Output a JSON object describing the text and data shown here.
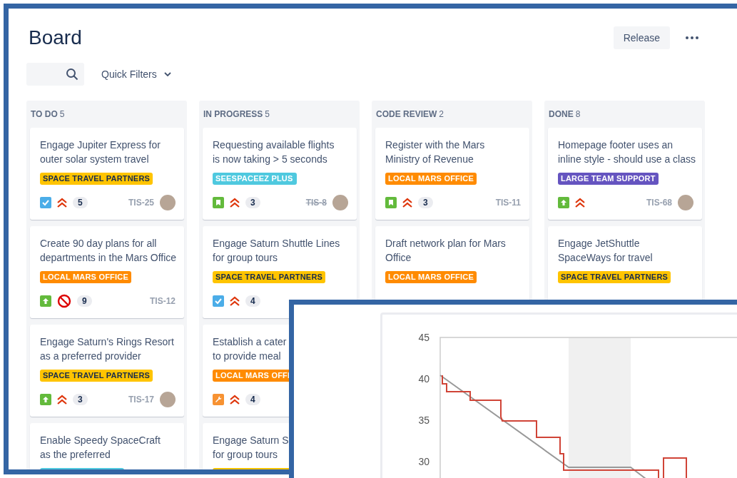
{
  "header": {
    "title": "Board",
    "release": "Release"
  },
  "toolbar": {
    "quick_filters": "Quick Filters"
  },
  "columns": [
    {
      "title": "TO DO",
      "count": "5",
      "cards": [
        {
          "lines": [
            "Engage Jupiter Express for",
            "outer solar system travel"
          ],
          "label": {
            "text": "SPACE TRAVEL PARTNERS",
            "color": "#ffc400"
          },
          "icons": [
            {
              "kind": "task"
            },
            {
              "kind": "highest"
            }
          ],
          "count": "5",
          "key": "TIS-25",
          "resolved": false,
          "assignee": true
        },
        {
          "lines": [
            "Create 90 day plans for all",
            "departments in the Mars Office"
          ],
          "label": {
            "text": "LOCAL MARS OFFICE",
            "color": "#ff8b00"
          },
          "icons": [
            {
              "kind": "improvement"
            },
            {
              "kind": "blocker"
            }
          ],
          "count": "9",
          "key": "TIS-12",
          "resolved": false,
          "assignee": false
        },
        {
          "lines": [
            "Engage Saturn's Rings Resort",
            "as a preferred provider"
          ],
          "label": {
            "text": "SPACE TRAVEL PARTNERS",
            "color": "#ffc400"
          },
          "icons": [
            {
              "kind": "improvement"
            },
            {
              "kind": "highest"
            }
          ],
          "count": "3",
          "key": "TIS-17",
          "resolved": false,
          "assignee": true
        },
        {
          "lines": [
            "Enable Speedy SpaceCraft",
            "as the preferred"
          ],
          "label": {
            "color": "#4fc9df"
          }
        }
      ]
    },
    {
      "title": "IN PROGRESS",
      "count": "5",
      "cards": [
        {
          "lines": [
            "Requesting available flights",
            "is now taking > 5 seconds"
          ],
          "label": {
            "text": "SEESPACEEZ PLUS",
            "color": "#4fc9df"
          },
          "icons": [
            {
              "kind": "story"
            },
            {
              "kind": "highest"
            }
          ],
          "count": "3",
          "key": "TIS-8",
          "resolved": true,
          "assignee": true
        },
        {
          "lines": [
            "Engage Saturn Shuttle Lines",
            "for group tours"
          ],
          "label": {
            "text": "SPACE TRAVEL PARTNERS",
            "color": "#ffc400"
          },
          "icons": [
            {
              "kind": "task"
            },
            {
              "kind": "highest"
            }
          ],
          "count": "4"
        },
        {
          "lines": [
            "Establish a cater",
            "to provide meal"
          ],
          "label": {
            "text": "LOCAL MARS OFFI",
            "color": "#ff8b00"
          },
          "icons": [
            {
              "kind": "wrench"
            },
            {
              "kind": "highest"
            }
          ],
          "count": "4"
        },
        {
          "lines": [
            "Engage Saturn S",
            "for group tours"
          ],
          "label": {
            "color": "#ffc400"
          }
        }
      ]
    },
    {
      "title": "CODE REVIEW",
      "count": "2",
      "cards": [
        {
          "lines": [
            "Register with the Mars",
            "Ministry of Revenue"
          ],
          "label": {
            "text": "LOCAL MARS OFFICE",
            "color": "#ff8b00"
          },
          "icons": [
            {
              "kind": "story"
            },
            {
              "kind": "highest"
            }
          ],
          "count": "3",
          "key": "TIS-11",
          "resolved": false,
          "assignee": false
        },
        {
          "lines": [
            "Draft network plan for Mars",
            "Office"
          ],
          "label": {
            "text": "LOCAL MARS OFFICE",
            "color": "#ff8b00"
          }
        }
      ]
    },
    {
      "title": "DONE",
      "count": "8",
      "cards": [
        {
          "lines": [
            "Homepage footer uses an",
            "inline style - should use a class"
          ],
          "label": {
            "text": "LARGE TEAM SUPPORT",
            "color": "#6554c0"
          },
          "icons": [
            {
              "kind": "improvement"
            },
            {
              "kind": "highest"
            }
          ],
          "key": "TIS-68",
          "resolved": false,
          "assignee": true
        },
        {
          "lines": [
            "Engage JetShuttle",
            "SpaceWays for travel"
          ],
          "label": {
            "text": "SPACE TRAVEL PARTNERS",
            "color": "#ffc400"
          }
        }
      ]
    }
  ],
  "overlay": {
    "yticks": [
      "45",
      "40",
      "35",
      "30"
    ]
  }
}
